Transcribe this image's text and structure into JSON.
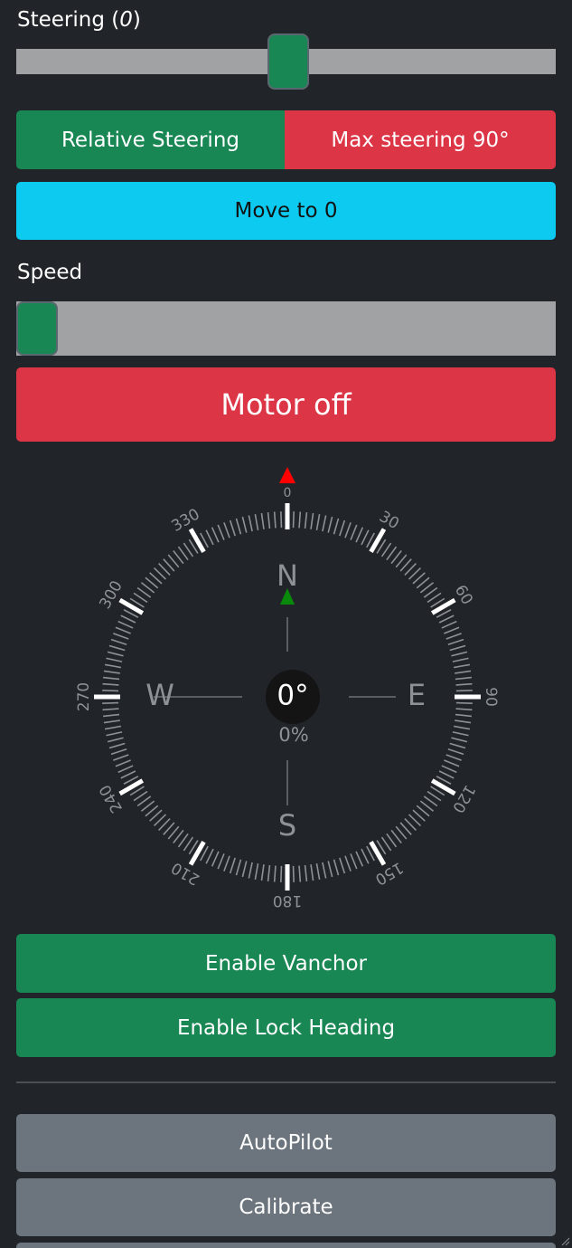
{
  "steering": {
    "label": "Steering",
    "value": "0",
    "position_fraction": 0.5
  },
  "steering_buttons": {
    "relative": "Relative Steering",
    "max": "Max steering 90°"
  },
  "move_to_zero": "Move to 0",
  "speed": {
    "label": "Speed",
    "position_fraction": 0.0
  },
  "motor_button": "Motor off",
  "compass": {
    "heading_text": "0°",
    "speed_text": "0%",
    "heading_value": 0,
    "cardinals": {
      "n": "N",
      "e": "E",
      "s": "S",
      "w": "W"
    },
    "degree_labels": [
      "0",
      "30",
      "60",
      "90",
      "120",
      "150",
      "180",
      "210",
      "240",
      "270",
      "300",
      "330"
    ],
    "marker_color": "#ff0000",
    "target_marker_color": "#0a8a0a"
  },
  "vanchor_button": "Enable Vanchor",
  "lock_heading_button": "Enable Lock Heading",
  "autopilot_button": "AutoPilot",
  "calibrate_button": "Calibrate",
  "colors": {
    "background": "#212529",
    "success": "#198754",
    "danger": "#dc3545",
    "info": "#0dcaf0",
    "secondary": "#6c757d"
  }
}
